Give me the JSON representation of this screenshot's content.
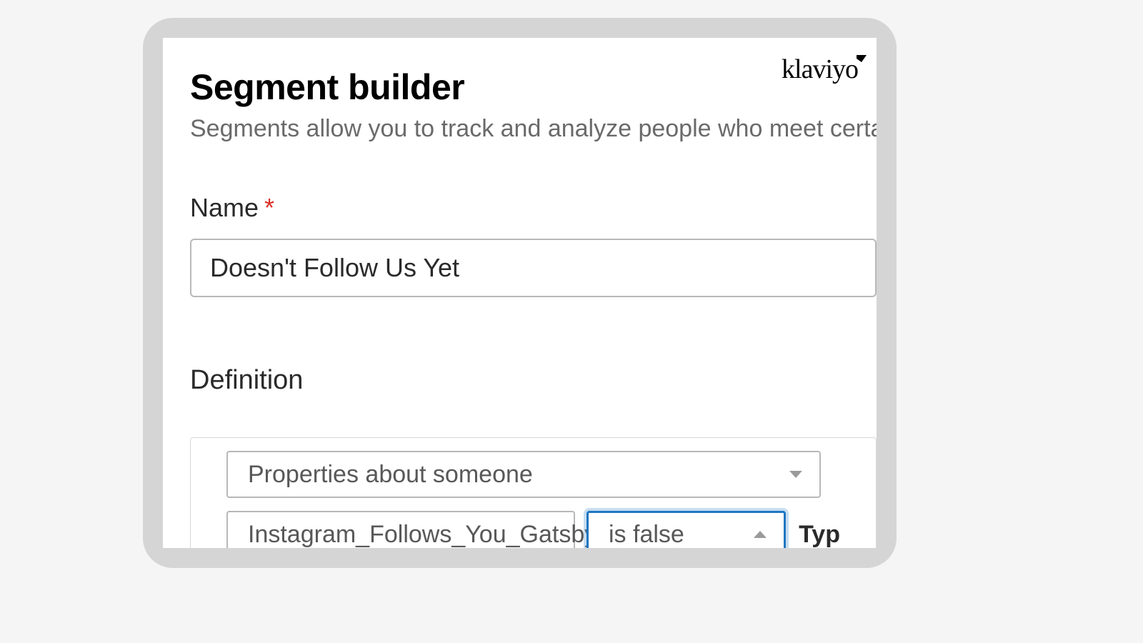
{
  "brand": {
    "logo_text": "klaviyo"
  },
  "header": {
    "title": "Segment builder",
    "subtitle": "Segments allow you to track and analyze people who meet certai"
  },
  "form": {
    "name_label": "Name",
    "name_value": "Doesn't Follow Us Yet"
  },
  "definition": {
    "section_label": "Definition",
    "condition_type": "Properties about someone",
    "property": "Instagram_Follows_You_Gatsby",
    "operator": "is false",
    "type_label_partial": "Typ"
  }
}
